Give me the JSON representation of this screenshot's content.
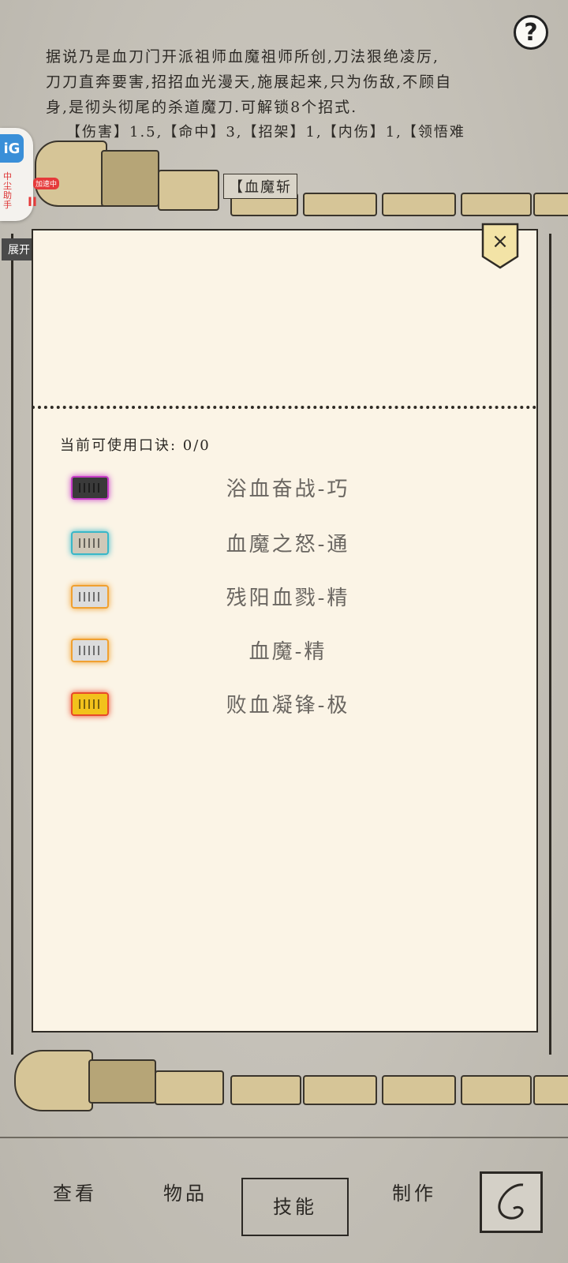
{
  "description": {
    "line1": "据说乃是血刀门开派祖师血魔祖师所创,刀法狠绝凌厉,",
    "line2": "刀刀直奔要害,招招血光漫天,施展起来,只为伤敌,不顾自",
    "line3": "身,是彻头彻尾的杀道魔刀.可解锁8个招式."
  },
  "stats_line": "【伤害】1.5,【命中】3,【招架】1,【内伤】1,【领悟难",
  "skill_tab_title": "【血魔斩",
  "help_label": "?",
  "assistant": {
    "logo": "iG",
    "vertical_text": "中尘助手",
    "speed_badge": "加速中",
    "pause_symbol": "II",
    "expand_label": "展开"
  },
  "panel": {
    "close_label": "×",
    "quota_label": "当前可使用口诀: 0/0",
    "skills": [
      {
        "name": "浴血奋战-巧",
        "color": "#c63cc6",
        "fill": "#3a3a3a"
      },
      {
        "name": "血魔之怒-通",
        "color": "#39b7c8",
        "fill": "#cfc8b8"
      },
      {
        "name": "残阳血戮-精",
        "color": "#f0a030",
        "fill": "#dcdcdc"
      },
      {
        "name": "血魔-精",
        "color": "#f0a030",
        "fill": "#dcdcdc"
      },
      {
        "name": "败血凝锋-极",
        "color": "#e84a2a",
        "fill": "#f2c21c"
      }
    ]
  },
  "bottom_nav": {
    "view": "查看",
    "items": "物品",
    "skills": "技能",
    "craft": "制作"
  }
}
